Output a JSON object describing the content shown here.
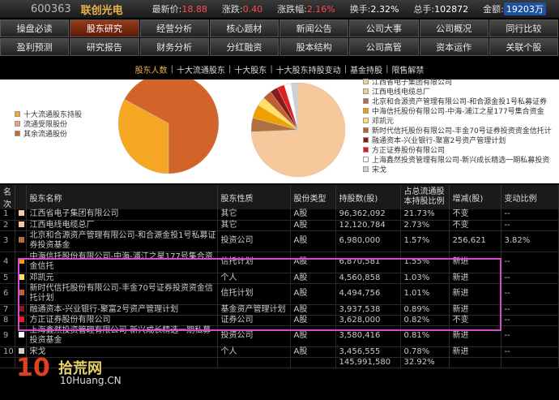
{
  "ticker": {
    "code": "600363",
    "name": "联创光电",
    "price_label": "最新价:",
    "price": "18.88",
    "change_label": "涨跌:",
    "change": "0.40",
    "pct_label": "涨跌幅:",
    "pct": "2.16%",
    "turnover_label": "换手:",
    "turnover": "2.32%",
    "hand_label": "总手:",
    "hand": "102872",
    "amount_label": "金额:",
    "amount": "19203万"
  },
  "nav": {
    "row1": [
      "操盘必读",
      "股东研究",
      "经营分析",
      "核心题材",
      "新闻公告",
      "公司大事",
      "公司概况",
      "同行比较"
    ],
    "row2": [
      "盈利预测",
      "研究报告",
      "财务分析",
      "分红融资",
      "股本结构",
      "公司高管",
      "资本运作",
      "关联个股"
    ],
    "active": "股东研究"
  },
  "subtabs": [
    "股东人数",
    "十大流通股东",
    "十大股东",
    "十大股东持股变动",
    "基金持股",
    "限售解禁"
  ],
  "left_legend": [
    {
      "label": "十大流通股东持股",
      "color": "#f5a623"
    },
    {
      "label": "流通受限股份",
      "color": "#f0a070"
    },
    {
      "label": "其余流通股份",
      "color": "#d2642a"
    }
  ],
  "right_legend": [
    {
      "label": "江西省电子集团有限公司",
      "color": "#f6c89a"
    },
    {
      "label": "江西电线电缆总厂",
      "color": "#f6c89a"
    },
    {
      "label": "北京和合源资产管理有限公司-和合源金投1号私募证券",
      "color": "#b07040"
    },
    {
      "label": "中海信托股份有限公司-中海-浦江之星177号集合资金",
      "color": "#f0a000"
    },
    {
      "label": "邓凯元",
      "color": "#ffe060"
    },
    {
      "label": "新时代信托股份有限公司-丰金70号证券投资资金信托计",
      "color": "#c06030"
    },
    {
      "label": "融通资本-兴业银行-聚富2号资产管理计划",
      "color": "#8a1a1a"
    },
    {
      "label": "方正证券股份有限公司",
      "color": "#e02020"
    },
    {
      "label": "上海鑫然投资管理有限公司-新兴成长精选一期私募投资",
      "color": "#ffffff"
    },
    {
      "label": "宋戈",
      "color": "#d0d0d0"
    }
  ],
  "table": {
    "headers": [
      "名次",
      "",
      "股东名称",
      "股东性质",
      "股份类型",
      "持股数(股)",
      "占总流通股本持股比例",
      "增减(股)",
      "变动比例"
    ],
    "rows": [
      {
        "rank": "1",
        "color": "#f6c89a",
        "name": "江西省电子集团有限公司",
        "nature": "其它",
        "type": "A股",
        "shares": "96,362,092",
        "ratio": "21.73%",
        "change": "不变",
        "change_pct": "--"
      },
      {
        "rank": "2",
        "color": "#f6c89a",
        "name": "江西电线电缆总厂",
        "nature": "其它",
        "type": "A股",
        "shares": "12,120,784",
        "ratio": "2.73%",
        "change": "不变",
        "change_pct": "--"
      },
      {
        "rank": "3",
        "color": "#b07040",
        "name": "北京和合源资产管理有限公司-和合源金投1号私募证券投资基金",
        "nature": "投资公司",
        "type": "A股",
        "shares": "6,980,000",
        "ratio": "1.57%",
        "change": "256,621",
        "change_pct": "3.82%"
      },
      {
        "rank": "4",
        "color": "#f0a000",
        "name": "中海信托股份有限公司-中海-浦江之星177号集合资金信托",
        "nature": "信托计划",
        "type": "A股",
        "shares": "6,870,581",
        "ratio": "1.55%",
        "change": "新进",
        "change_pct": "--"
      },
      {
        "rank": "5",
        "color": "#ffe060",
        "name": "邓凯元",
        "nature": "个人",
        "type": "A股",
        "shares": "4,560,858",
        "ratio": "1.03%",
        "change": "新进",
        "change_pct": "--"
      },
      {
        "rank": "6",
        "color": "#c06030",
        "name": "新时代信托股份有限公司-丰金70号证券投资资金信托计划",
        "nature": "信托计划",
        "type": "A股",
        "shares": "4,494,756",
        "ratio": "1.01%",
        "change": "新进",
        "change_pct": "--"
      },
      {
        "rank": "7",
        "color": "#8a1a1a",
        "name": "融通资本-兴业银行-聚富2号资产管理计划",
        "nature": "基金资产管理计划",
        "type": "A股",
        "shares": "3,937,538",
        "ratio": "0.89%",
        "change": "新进",
        "change_pct": "--"
      },
      {
        "rank": "8",
        "color": "#e02020",
        "name": "方正证券股份有限公司",
        "nature": "证券公司",
        "type": "A股",
        "shares": "3,628,000",
        "ratio": "0.82%",
        "change": "不变",
        "change_pct": "--"
      },
      {
        "rank": "9",
        "color": "#ffffff",
        "name": "上海鑫然投资管理有限公司-新兴成长精选一期私募投资基金",
        "nature": "投资公司",
        "type": "A股",
        "shares": "3,580,416",
        "ratio": "0.81%",
        "change": "新进",
        "change_pct": "--"
      },
      {
        "rank": "10",
        "color": "#d0d0d0",
        "name": "宋戈",
        "nature": "个人",
        "type": "A股",
        "shares": "3,456,555",
        "ratio": "0.78%",
        "change": "新进",
        "change_pct": "--"
      },
      {
        "rank": "",
        "color": "",
        "name": "",
        "nature": "",
        "type": "",
        "shares": "145,991,580",
        "ratio": "32.92%",
        "change": "",
        "change_pct": ""
      }
    ]
  },
  "chart_data": [
    {
      "type": "pie",
      "labels": [
        "十大流通股东持股",
        "流通受限股份",
        "其余流通股份"
      ],
      "values": [
        32.92,
        0,
        67.08
      ]
    },
    {
      "type": "pie",
      "labels": [
        "江西省电子集团有限公司",
        "江西电线电缆总厂",
        "北京和合源资产管理有限公司-和合源金投1号私募证券",
        "中海信托股份有限公司-中海-浦江之星177号集合资金",
        "邓凯元",
        "新时代信托股份有限公司-丰金70号证券投资资金信托计",
        "融通资本-兴业银行-聚富2号资产管理计划",
        "方正证券股份有限公司",
        "上海鑫然投资管理有限公司-新兴成长精选一期私募投资",
        "宋戈"
      ],
      "values": [
        96362092,
        12120784,
        6980000,
        6870581,
        4560858,
        4494756,
        3937538,
        3628000,
        3580416,
        3456555
      ]
    }
  ],
  "watermark": {
    "logo": "10",
    "text": "拾荒网",
    "url": "10Huang.CN"
  }
}
